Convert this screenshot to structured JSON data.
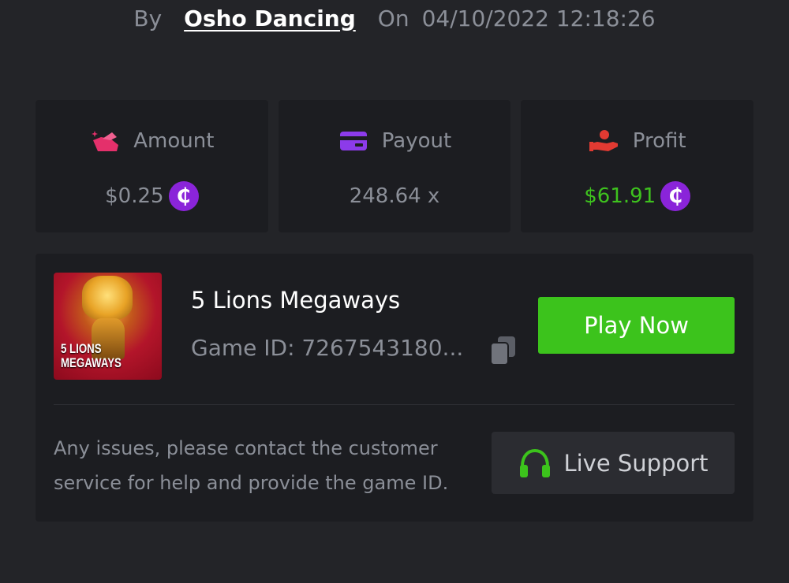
{
  "header": {
    "by_label": "By",
    "author": "Osho Dancing",
    "on_label": "On",
    "datetime": "04/10/2022 12:18:26"
  },
  "stats": [
    {
      "label": "Amount",
      "value": "$0.25",
      "icon": "amount-icon",
      "icon_color": "#e4306b",
      "show_coin": true
    },
    {
      "label": "Payout",
      "value": "248.64 x",
      "icon": "payout-card-icon",
      "icon_color": "#8c3bea",
      "show_coin": false
    },
    {
      "label": "Profit",
      "value": "$61.91",
      "icon": "profit-hand-icon",
      "icon_color": "#e23a32",
      "show_coin": true,
      "value_color": "#3ec21e"
    }
  ],
  "coin_symbol": "₵",
  "game": {
    "title": "5 Lions Megaways",
    "game_id": "Game ID: 7267543180...",
    "thumbnail_text": "5 LIONS\nMEGAWAYS",
    "play_label": "Play Now",
    "play_color": "#3cc31c"
  },
  "support": {
    "message": "Any issues, please contact the customer service for help and provide the game ID.",
    "button_label": "Live Support",
    "icon_color": "#3cc31c"
  }
}
